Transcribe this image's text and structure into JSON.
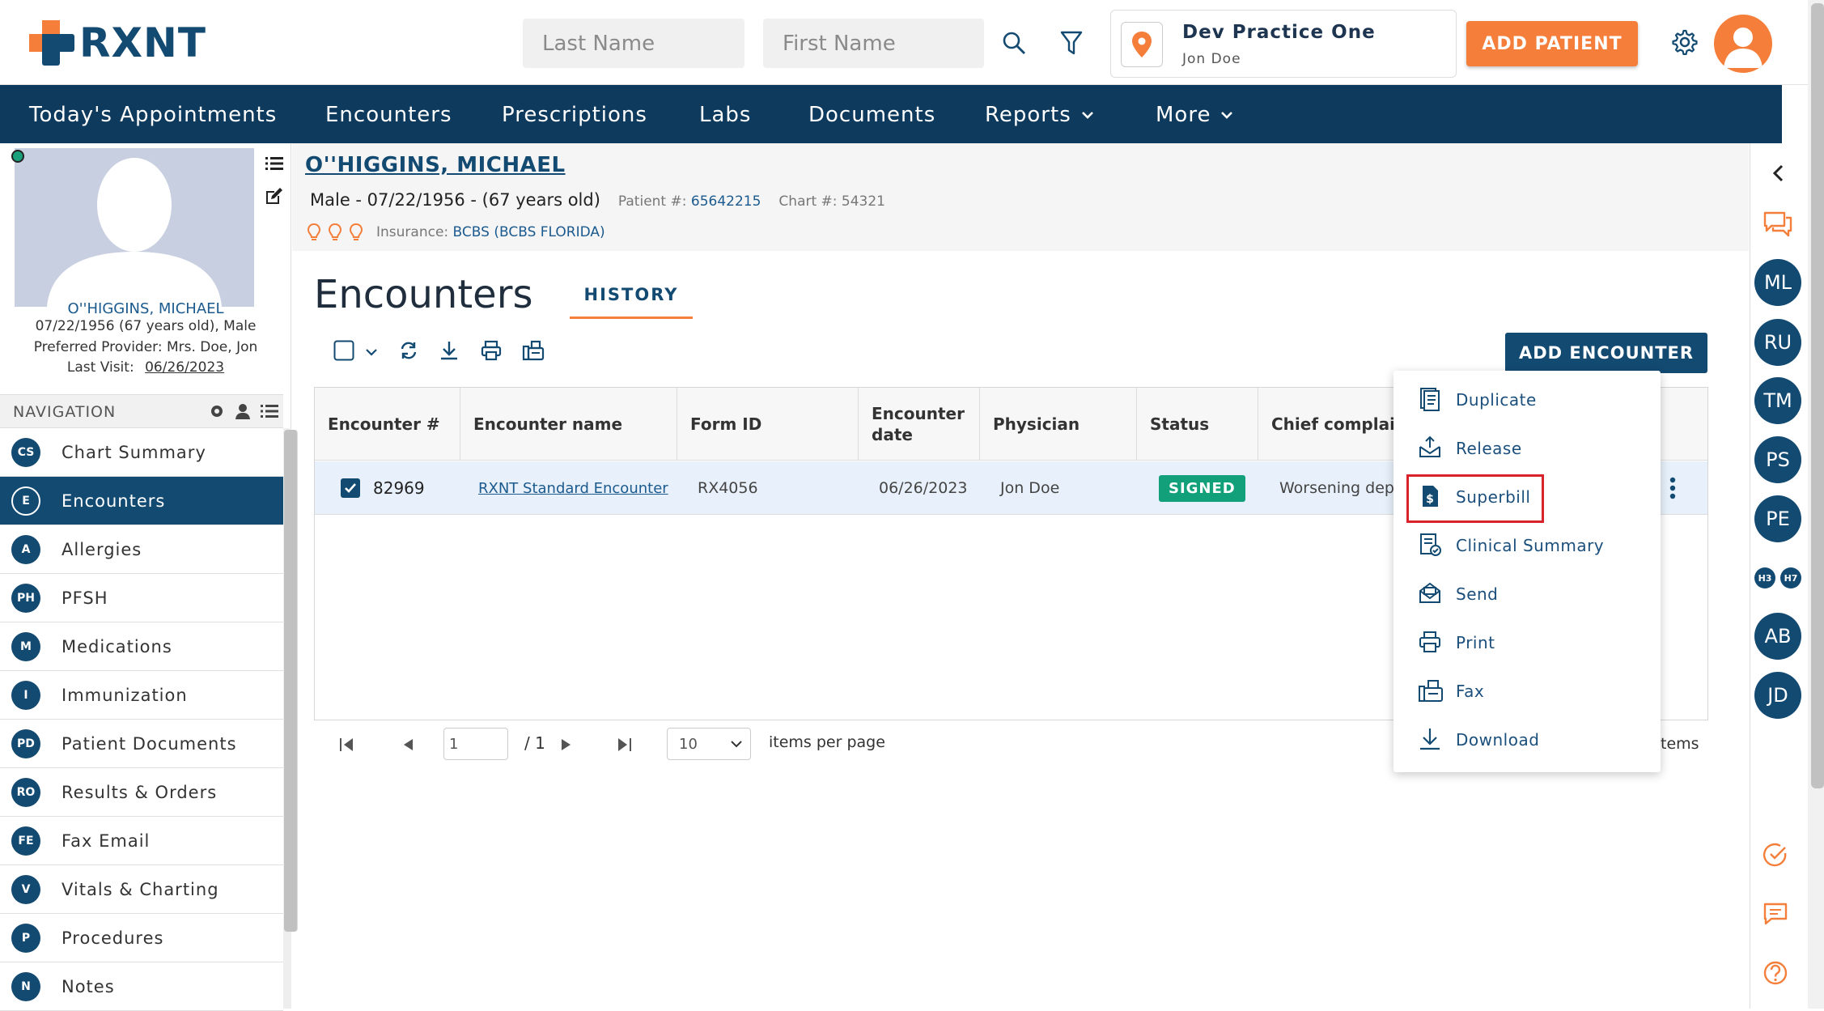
{
  "brand": {
    "name": "RXNT",
    "orange": "#f47e3a",
    "navy": "#134a72"
  },
  "search": {
    "last_placeholder": "Last Name",
    "first_placeholder": "First Name"
  },
  "practice": {
    "name": "Dev Practice One",
    "user": "Jon Doe"
  },
  "header": {
    "add_patient": "ADD PATIENT"
  },
  "nav": [
    "Today's Appointments",
    "Encounters",
    "Prescriptions",
    "Labs",
    "Documents",
    "Reports",
    "More"
  ],
  "patient": {
    "name": "O''HIGGINS, MICHAEL",
    "dob_line": "07/22/1956 (67 years old), Male",
    "provider_line": "Preferred Provider: Mrs. Doe, Jon",
    "last_visit_label": "Last Visit:",
    "last_visit": "06/26/2023",
    "summary": "Male - 07/22/1956 - (67 years old)",
    "patient_no_label": "Patient #:",
    "patient_no": "65642215",
    "chart_no": "Chart #: 54321",
    "insurance_label": "Insurance:",
    "insurance": "BCBS (BCBS FLORIDA)"
  },
  "sidenav": {
    "title": "NAVIGATION",
    "items": [
      {
        "abbr": "CS",
        "label": "Chart Summary"
      },
      {
        "abbr": "E",
        "label": "Encounters"
      },
      {
        "abbr": "A",
        "label": "Allergies"
      },
      {
        "abbr": "PH",
        "label": "PFSH"
      },
      {
        "abbr": "M",
        "label": "Medications"
      },
      {
        "abbr": "I",
        "label": "Immunization"
      },
      {
        "abbr": "PD",
        "label": "Patient Documents"
      },
      {
        "abbr": "RO",
        "label": "Results & Orders"
      },
      {
        "abbr": "FE",
        "label": "Fax Email"
      },
      {
        "abbr": "V",
        "label": "Vitals & Charting"
      },
      {
        "abbr": "P",
        "label": "Procedures"
      },
      {
        "abbr": "N",
        "label": "Notes"
      }
    ]
  },
  "encounters": {
    "title": "Encounters",
    "history_tab": "HISTORY",
    "add_button": "ADD ENCOUNTER",
    "columns": [
      "Encounter #",
      "Encounter name",
      "Form ID",
      "Encounter date",
      "Physician",
      "Status",
      "Chief complain"
    ],
    "row": {
      "number": "82969",
      "name": "RXNT Standard Encounter",
      "form_id": "RX4056",
      "date": "06/26/2023",
      "physician": "Jon Doe",
      "status": "SIGNED",
      "complaint": "Worsening depr"
    },
    "pager": {
      "page": "1",
      "total": "/ 1",
      "per_page": "10",
      "per_page_label": "items per page",
      "items_tail": "tems"
    }
  },
  "menu": [
    "Duplicate",
    "Release",
    "Superbill",
    "Clinical Summary",
    "Send",
    "Print",
    "Fax",
    "Download"
  ],
  "rail": {
    "avatars": [
      "ML",
      "RU",
      "TM",
      "PS",
      "PE",
      "AB",
      "JD"
    ],
    "small": [
      "H3",
      "H7"
    ]
  }
}
